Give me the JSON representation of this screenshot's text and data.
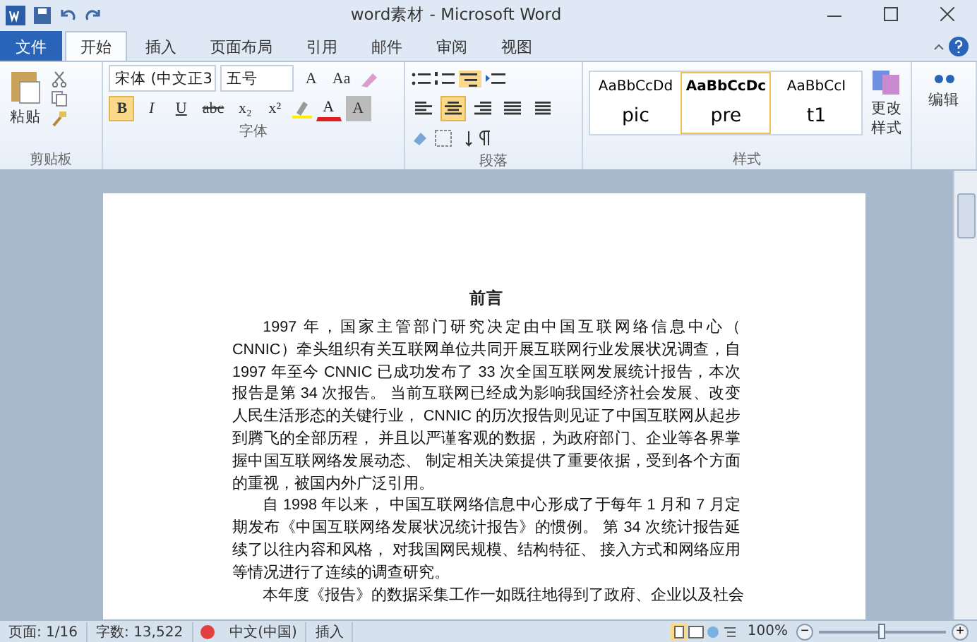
{
  "window": {
    "title": "word素材 - Microsoft Word"
  },
  "tabs": [
    {
      "label": "文件",
      "kind": "file",
      "selected": false
    },
    {
      "label": "开始",
      "kind": "tab",
      "selected": true
    },
    {
      "label": "插入",
      "kind": "tab",
      "selected": false
    },
    {
      "label": "页面布局",
      "kind": "tab",
      "selected": false
    },
    {
      "label": "引用",
      "kind": "tab",
      "selected": false
    },
    {
      "label": "邮件",
      "kind": "tab",
      "selected": false
    },
    {
      "label": "审阅",
      "kind": "tab",
      "selected": false
    },
    {
      "label": "视图",
      "kind": "tab",
      "selected": false
    }
  ],
  "ribbon": {
    "clipboard": {
      "title": "剪贴板",
      "paste": "粘贴"
    },
    "font": {
      "title": "字体",
      "font_name": "宋体 (中文正3",
      "font_size": "五号",
      "grow": "A",
      "bold": {
        "label": "B",
        "selected": true
      },
      "italic": "I",
      "underline": "U",
      "strike": "abc",
      "sub": "x₂",
      "sup": "x²",
      "case": "Aa",
      "font_color": "A",
      "shade": "A"
    },
    "paragraph": {
      "title": "段落",
      "alignments": [
        {
          "selected": false
        },
        {
          "selected": true
        },
        {
          "selected": false
        },
        {
          "selected": false
        },
        {
          "selected": false
        }
      ]
    },
    "styles": {
      "title": "样式",
      "items": [
        {
          "sample": "AaBbCcDd",
          "name": "pic",
          "selected": false
        },
        {
          "sample": "AaBbCcDc",
          "name": "pre",
          "selected": true
        },
        {
          "sample": "AaBbCcI",
          "name": "t1",
          "selected": false
        }
      ],
      "change": "更改样式"
    },
    "editing": {
      "label": "编辑"
    }
  },
  "document": {
    "heading": "前言",
    "paragraphs": [
      "1997 年，国家主管部门研究决定由中国互联网络信息中心（ CNNIC）牵头组织有关互联网单位共同开展互联网行业发展状况调查，自 1997 年至今 CNNIC 已成功发布了 33 次全国互联网发展统计报告，本次报告是第 34 次报告。 当前互联网已经成为影响我国经济社会发展、改变人民生活形态的关键行业， CNNIC 的历次报告则见证了中国互联网从起步到腾飞的全部历程， 并且以严谨客观的数据，为政府部门、企业等各界掌握中国互联网络发展动态、 制定相关决策提供了重要依据，受到各个方面的重视，被国内外广泛引用。",
      "自 1998 年以来， 中国互联网络信息中心形成了于每年 1 月和 7 月定期发布《中国互联网络发展状况统计报告》的惯例。 第 34 次统计报告延续了以往内容和风格， 对我国网民规模、结构特征、 接入方式和网络应用等情况进行了连续的调查研究。",
      "本年度《报告》的数据采集工作一如既往地得到了政府、企业以及社会"
    ]
  },
  "status_bar": {
    "page": "页面: 1/16",
    "words": "字数: 13,522",
    "language": "中文(中国)",
    "mode": "插入",
    "zoom": "100%",
    "zoom_minus": "−",
    "zoom_plus": "+",
    "level": 0.5
  }
}
